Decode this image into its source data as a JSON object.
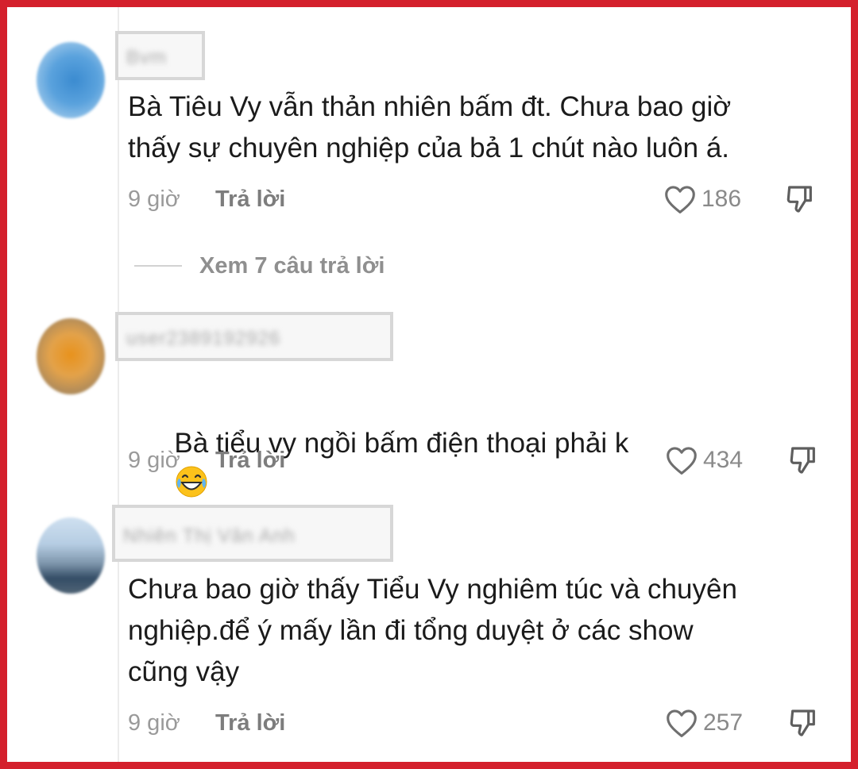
{
  "comments": [
    {
      "username": "Bvm",
      "text": "Bà Tiêu Vy vẫn thản nhiên bấm đt. Chưa bao giờ\nthấy sự chuyên nghiệp của bả 1 chút nào luôn á.",
      "time": "9 giờ",
      "reply_label": "Trả lời",
      "likes": "186"
    },
    {
      "username": "user2389192926",
      "text": "Bà tiểu vy ngồi bấm điện thoại phải k",
      "emoji": "face-with-tears-of-joy",
      "time": "9 giờ",
      "reply_label": "Trả lời",
      "likes": "434"
    },
    {
      "username": "Nhiên Thị Vân Anh",
      "text": "Chưa bao giờ thấy Tiểu Vy nghiêm túc và chuyên\nnghiệp.để ý mấy lần đi tổng duyệt ở các show\ncũng vậy",
      "time": "9 giờ",
      "reply_label": "Trả lời",
      "likes": "257"
    }
  ],
  "view_replies": "Xem 7 câu trả lời",
  "colors": {
    "frame": "#d4202c",
    "text": "#1b1b1b",
    "muted": "#9a9a9a"
  },
  "icons": [
    "heart-icon",
    "dislike-icon",
    "laughing-emoji-icon"
  ]
}
